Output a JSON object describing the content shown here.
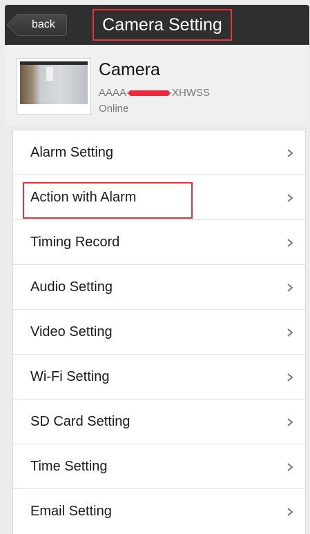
{
  "header": {
    "back_label": "back",
    "title": "Camera Setting"
  },
  "camera": {
    "name": "Camera",
    "id_prefix": "AAAA-",
    "id_suffix": "-XHWSS",
    "status": "Online"
  },
  "menu": {
    "items": [
      {
        "label": "Alarm Setting"
      },
      {
        "label": "Action with Alarm"
      },
      {
        "label": "Timing Record"
      },
      {
        "label": "Audio Setting"
      },
      {
        "label": "Video Setting"
      },
      {
        "label": "Wi-Fi Setting"
      },
      {
        "label": "SD Card Setting"
      },
      {
        "label": "Time Setting"
      },
      {
        "label": "Email Setting"
      }
    ]
  },
  "colors": {
    "highlight": "#e8323c",
    "titlebar": "#2f2f2f",
    "redaction": "#f2263a"
  }
}
